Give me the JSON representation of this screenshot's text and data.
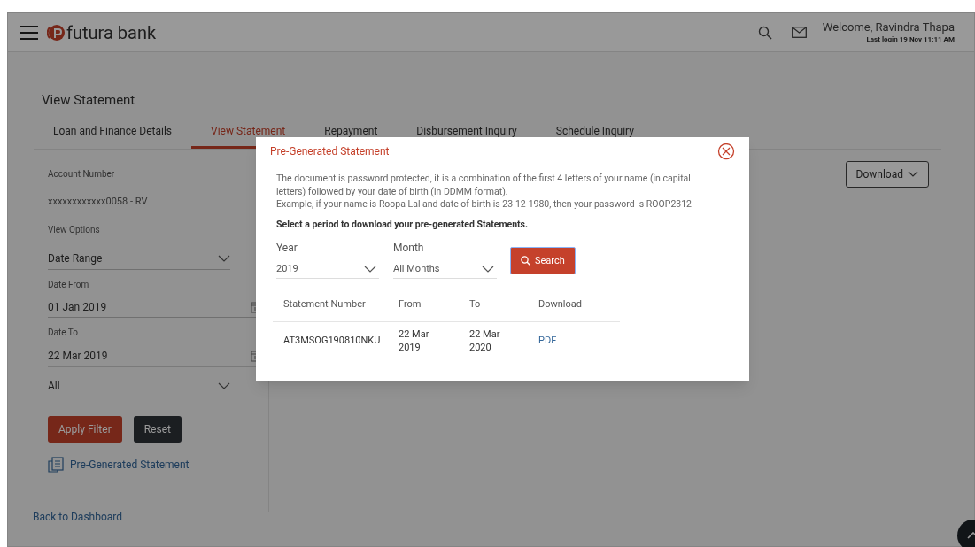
{
  "header": {
    "brand": "futura bank",
    "welcome": "Welcome, Ravindra Thapa",
    "last_login": "Last login 19 Nov 11:11 AM"
  },
  "page_title": "View Statement",
  "tabs": [
    {
      "label": "Loan and Finance Details",
      "selected": false
    },
    {
      "label": "View Statement",
      "selected": true
    },
    {
      "label": "Repayment",
      "selected": false
    },
    {
      "label": "Disbursement Inquiry",
      "selected": false
    },
    {
      "label": "Schedule Inquiry",
      "selected": false
    }
  ],
  "filters": {
    "account_label": "Account Number",
    "account_value": "xxxxxxxxxxxx0058 - RV",
    "view_options_label": "View Options",
    "view_option": "Date Range",
    "date_from_label": "Date From",
    "date_from": "01 Jan 2019",
    "date_to_label": "Date To",
    "date_to": "22 Mar 2019",
    "type": "All",
    "apply_button": "Apply Filter",
    "reset_button": "Reset",
    "pre_generated_link": "Pre-Generated Statement"
  },
  "download_button": "Download",
  "back_link": "Back to Dashboard",
  "modal": {
    "title": "Pre-Generated Statement",
    "info": "The document is password protected, it is a combination of the first 4 letters of your name (in capital letters) followed by your date of birth (in DDMM format).",
    "example": "Example, if your name is Roopa Lal and date of birth is 23-12-1980, then your password is ROOP2312",
    "prompt": "Select a period to download your pre-generated Statements.",
    "year_label": "Year",
    "year": "2019",
    "month_label": "Month",
    "month": "All Months",
    "search_button": "Search",
    "table": {
      "columns": [
        "Statement Number",
        "From",
        "To",
        "Download"
      ],
      "rows": [
        {
          "statement_number": "AT3MSOG190810NKU",
          "from": "22 Mar 2019",
          "to": "22 Mar 2020",
          "download": "PDF"
        }
      ]
    }
  }
}
